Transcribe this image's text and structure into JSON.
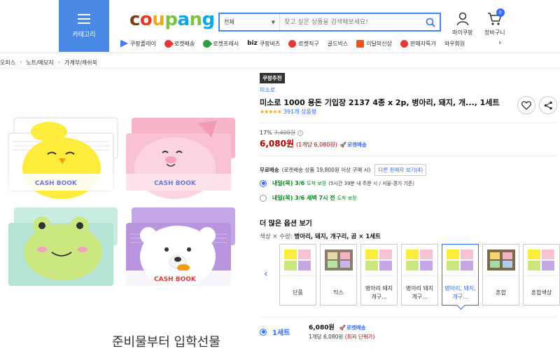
{
  "header": {
    "category_label": "카테고리",
    "logo": "coupang",
    "search": {
      "select_value": "전체",
      "placeholder": "찾고 싶은 상품을 검색해보세요!"
    },
    "my_coupang": "마이쿠팡",
    "cart": "장바구니",
    "cart_count": "0",
    "quicknav": [
      {
        "label": "쿠팡플레이",
        "icon": "play-icon",
        "color": "#3b82f6"
      },
      {
        "label": "로켓배송",
        "icon": "rocket-icon",
        "color": "#e53935"
      },
      {
        "label": "로켓프레시",
        "icon": "rocket-fresh-icon",
        "color": "#2e9d3b"
      },
      {
        "label": "쿠팡비즈",
        "icon": "biz-icon",
        "color": "#222222"
      },
      {
        "label": "로켓직구",
        "icon": "rocket-global-icon",
        "color": "#e53935"
      },
      {
        "label": "골드박스",
        "icon": "goldbox-icon",
        "color": "#ffffff"
      },
      {
        "label": "이달의신상",
        "icon": "new-icon",
        "color": "#f4511e"
      },
      {
        "label": "판매자특가",
        "icon": "seller-deal-icon",
        "color": "#e53935"
      },
      {
        "label": "와우회원",
        "icon": "wow-icon",
        "color": "#ffffff"
      }
    ]
  },
  "breadcrumb": [
    "오피스",
    "노트/메모지",
    "가계부/캐쉬북"
  ],
  "product": {
    "badge": "쿠팡추천",
    "brand": "미소로",
    "title": "미소로 1000 용돈 기입장 2137 4종 x 2p, 병아리, 돼지, 개..., 1세트",
    "stars": "★★★★★",
    "rating_count": "391개 상품평",
    "discount": "17%",
    "original_price": "7,400원",
    "price": "6,080원",
    "unit_price": "(1개당 6,080원)",
    "rocket_label": "로켓배송",
    "book_label": "CASH BOOK",
    "caption": "준비물부터 입학선물"
  },
  "shipping": {
    "free": "무료배송",
    "condition": "(로켓배송 상품 19,800원 이상 구매 시)",
    "other_seller": "다른 판매자 보기(4)",
    "options": [
      {
        "date": "내일(목) 3/6",
        "type": "도착 보장",
        "detail": "(5시간 39분 내 주문 시 / 서울⋅경기 기준)",
        "selected": true
      },
      {
        "date": "내일(목) 3/6 새벽 7시 전",
        "type": "도착 보장",
        "detail": "",
        "selected": false
      }
    ]
  },
  "options": {
    "heading": "더 많은 옵션 보기",
    "summary_label": "색상 × 수량:",
    "summary_value": "병아리, 돼지, 개구리, 곰 × 1세트",
    "cards": [
      {
        "label": "단품",
        "selected": false
      },
      {
        "label": "믹스",
        "selected": false
      },
      {
        "label": "병아리 돼지 개구...",
        "selected": false
      },
      {
        "label": "병아리 돼지 개구...",
        "selected": false
      },
      {
        "label": "병아리, 돼지, 개구...",
        "selected": true
      },
      {
        "label": "혼합",
        "selected": false
      },
      {
        "label": "혼합색상",
        "selected": false
      }
    ]
  },
  "selection": {
    "qty": "1세트",
    "price": "6,080원",
    "rocket": "로켓배송",
    "unit": "1개당 6,080원",
    "lowest": "(최저 단위가)"
  },
  "colors": {
    "brand_blue": "#346aff",
    "category_blue": "#4a88e6",
    "price_red": "#ae0000",
    "delivery_green": "#00891a"
  }
}
